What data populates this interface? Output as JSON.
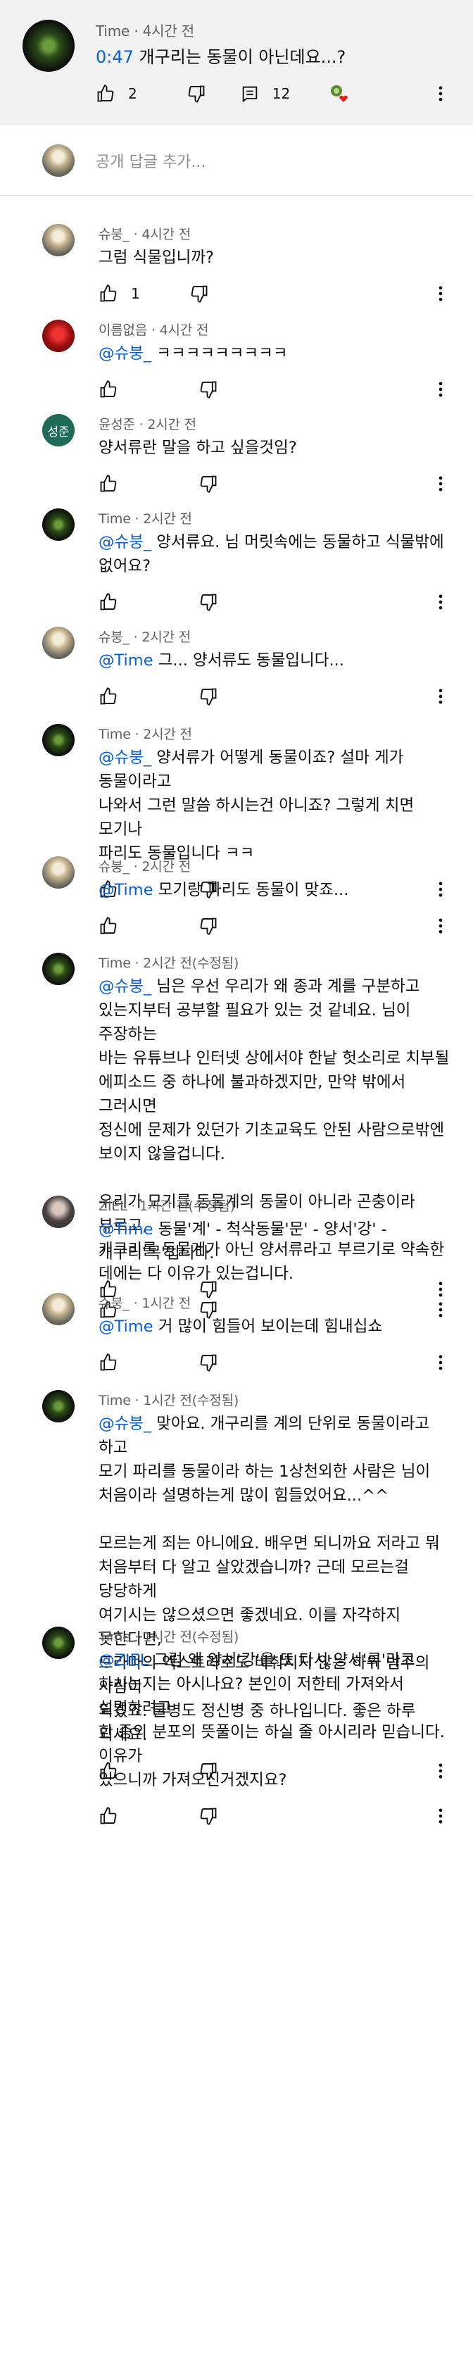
{
  "parent": {
    "author": "Time",
    "time": "4시간 전",
    "timestamp_link": "0:47",
    "text": " 개구리는 동물이 아닌데요...?",
    "likes": "2",
    "replies": "12"
  },
  "reply_input": {
    "placeholder": "공개 답글 추가..."
  },
  "replies": [
    {
      "author": "슈붕_",
      "time": "4시간 전",
      "mention": "",
      "text": "그럼 식물입니까?",
      "likes": "1",
      "avatar": "sky"
    },
    {
      "author": "이름없음",
      "time": "4시간 전",
      "mention": "@슈붕_",
      "text": " ㅋㅋㅋㅋㅋㅋㅋㅋㅋ",
      "likes": "",
      "avatar": "red"
    },
    {
      "author": "윤성준",
      "time": "2시간 전",
      "mention": "",
      "text": "양서류란 말을 하고 싶을것임?",
      "likes": "",
      "avatar": "teal",
      "avatar_text": "성준"
    },
    {
      "author": "Time",
      "time": "2시간 전",
      "mention": "@슈붕_",
      "text": " 양서류요. 님 머릿속에는 동물하고 식물밖에\n없어요?",
      "likes": "",
      "avatar": "weed"
    },
    {
      "author": "슈붕_",
      "time": "2시간 전",
      "mention": "@Time",
      "text": " 그... 양서류도 동물입니다...",
      "likes": "",
      "avatar": "sky"
    },
    {
      "author": "Time",
      "time": "2시간 전",
      "mention": "@슈붕_",
      "text": " 양서류가 어떻게 동물이죠? 설마 게가 동물이라고\n나와서 그런 말씀 하시는건 아니죠? 그렇게 치면 모기나\n파리도 동물입니다 ㅋㅋ",
      "likes": "",
      "avatar": "weed"
    },
    {
      "author": "슈붕_",
      "time": "2시간 전",
      "mention": "@Time",
      "text": " 모기랑 파리도 동물이 맞죠...",
      "likes": "",
      "avatar": "sky"
    },
    {
      "author": "Time",
      "time": "2시간 전(수정됨)",
      "mention": "@슈붕_",
      "text": " 님은 우선 우리가 왜 종과 계를 구분하고\n있는지부터 공부할 필요가 있는 것 같네요. 님이 주장하는\n바는 유튜브나 인터넷 상에서야 한낱 헛소리로 치부될\n에피소드 중 하나에 불과하겠지만, 만약 밖에서 그러시면\n정신에 문제가 있던가 기초교육도 안된 사람으로밖엔\n보이지 않을겁니다.\n\n우리가 모기를 동물계의 동물이 아니라 곤충이라 부르고,\n개구리를 동물계가 아닌 양서류라고 부르기로 약속한\n데에는 다 이유가 있는겁니다.",
      "likes": "",
      "avatar": "weed"
    },
    {
      "author": "ZIEL",
      "time": "1시간 전(수정됨)",
      "mention": "@Time",
      "text": " 동물'계' - 척삭동물'문' - 양서'강' -\n개구리'목'입니다.",
      "likes": "",
      "avatar": "person"
    },
    {
      "author": "슈붕_",
      "time": "1시간 전",
      "mention": "@Time",
      "text": " 거 많이 힘들어 보이는데 힘내십쇼",
      "likes": "",
      "avatar": "sky"
    },
    {
      "author": "Time",
      "time": "1시간 전(수정됨)",
      "mention": "@슈붕_",
      "text": " 맞아요. 개구리를 계의 단위로 동물이라고 하고\n모기 파리를 동물이라 하는 1상천외한 사람은 님이\n처음이라 설명하는게 많이 힘들었어요...^^\n\n모르는게 죄는 아니에요. 배우면 되니까요 저라고 뭐\n처음부터 다 알고 살았겠습니까? 근데 모르는걸 당당하게\n여기시는 않으셨으면 좋겠네요. 이를 자각하지 못한다면,\n드라마의 엑스트라로도 비춰지지 않는 하위 범주의 사람이\n되겠죠. 쿨병도 정신병 중 하나입니다. 좋은 하루 되세요.",
      "likes": "",
      "avatar": "weed"
    },
    {
      "author": "Time",
      "time": "1시간 전(수정됨)",
      "mention": "@ZIEL",
      "text": " 그럼 왜 양서'강'을 또 다시 양서'류'라고\n하시는지는 아시나요? 본인이 저한테 가져와서 설명하려고\n한 종의 분포의 뜻풀이는 하실 줄 아시리라 믿습니다. 이유가\n있으니까 가져오신거겠지요?",
      "likes": "",
      "avatar": "weed"
    }
  ],
  "colors": {
    "link": "#065fd4",
    "parent_bg": "#f2f2f2",
    "meta": "#606060"
  },
  "icons": [
    "thumbs-up-icon",
    "thumbs-down-icon",
    "comment-icon",
    "heart-badge-icon",
    "more-vert-icon"
  ]
}
